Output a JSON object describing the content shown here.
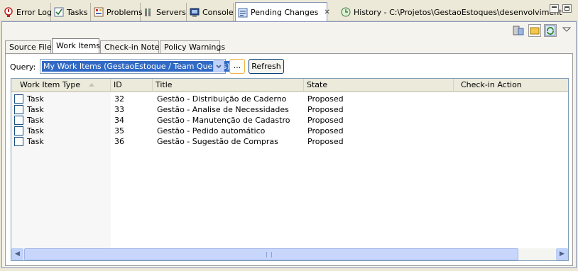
{
  "view_tabs": [
    {
      "label": "Error Log",
      "icon": "error-log-icon"
    },
    {
      "label": "Tasks",
      "icon": "tasks-icon"
    },
    {
      "label": "Problems",
      "icon": "problems-icon"
    },
    {
      "label": "Servers",
      "icon": "servers-icon"
    },
    {
      "label": "Console",
      "icon": "console-icon"
    },
    {
      "label": "Pending Changes",
      "icon": "pending-changes-icon",
      "active": true,
      "close": "✕"
    },
    {
      "label": "History - C:\\Projetos\\GestaoEstoques\\desenvolviment",
      "icon": "history-icon"
    }
  ],
  "sub_tabs": [
    "Source Files",
    "Work Items",
    "Check-in Notes",
    "Policy Warnings"
  ],
  "active_sub_tab": "Work Items",
  "query": {
    "label": "Query:",
    "selected": "My Work Items (GestaoEstoque / Team Queries)",
    "browse_label": "...",
    "refresh_label": "Refresh"
  },
  "table": {
    "columns": [
      "Work Item Type",
      "ID",
      "Title",
      "State",
      "Check-in Action"
    ],
    "sort_column": "Work Item Type",
    "rows": [
      {
        "type": "Task",
        "id": "32",
        "title": "Gestão - Distribuição de Caderno",
        "state": "Proposed",
        "action": ""
      },
      {
        "type": "Task",
        "id": "33",
        "title": "Gestão - Analise de Necessidades",
        "state": "Proposed",
        "action": ""
      },
      {
        "type": "Task",
        "id": "34",
        "title": "Gestão - Manutenção de Cadastro",
        "state": "Proposed",
        "action": ""
      },
      {
        "type": "Task",
        "id": "35",
        "title": "Gestão - Pedido automático",
        "state": "Proposed",
        "action": ""
      },
      {
        "type": "Task",
        "id": "36",
        "title": "Gestão - Sugestão de Compras",
        "state": "Proposed",
        "action": ""
      }
    ]
  },
  "colors": {
    "accent": "#316ac5",
    "panel_border": "#8b99b8",
    "header_bg": "#ebeadb"
  }
}
